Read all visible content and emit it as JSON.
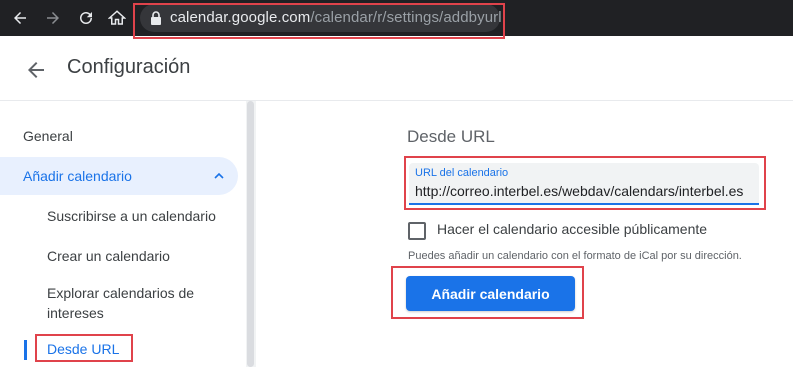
{
  "browser": {
    "url_host": "calendar.google.com",
    "url_path": "/calendar/r/settings/addbyurl"
  },
  "header": {
    "title": "Configuración"
  },
  "sidebar": {
    "general": "General",
    "add_calendar": "Añadir calendario",
    "sub_items": [
      "Suscribirse a un calendario",
      "Crear un calendario",
      "Explorar calendarios de intereses",
      "Desde URL"
    ]
  },
  "main": {
    "section_title": "Desde URL",
    "url_field": {
      "label": "URL del calendario",
      "value": "http://correo.interbel.es/webdav/calendars/interbel.es"
    },
    "public_checkbox": {
      "label": "Hacer el calendario accesible públicamente",
      "checked": false
    },
    "hint": "Puedes añadir un calendario con el formato de iCal por su dirección.",
    "add_button": "Añadir calendario"
  },
  "colors": {
    "accent": "#1a73e8",
    "annotation": "#e0434b",
    "browser_bar": "#202124"
  }
}
